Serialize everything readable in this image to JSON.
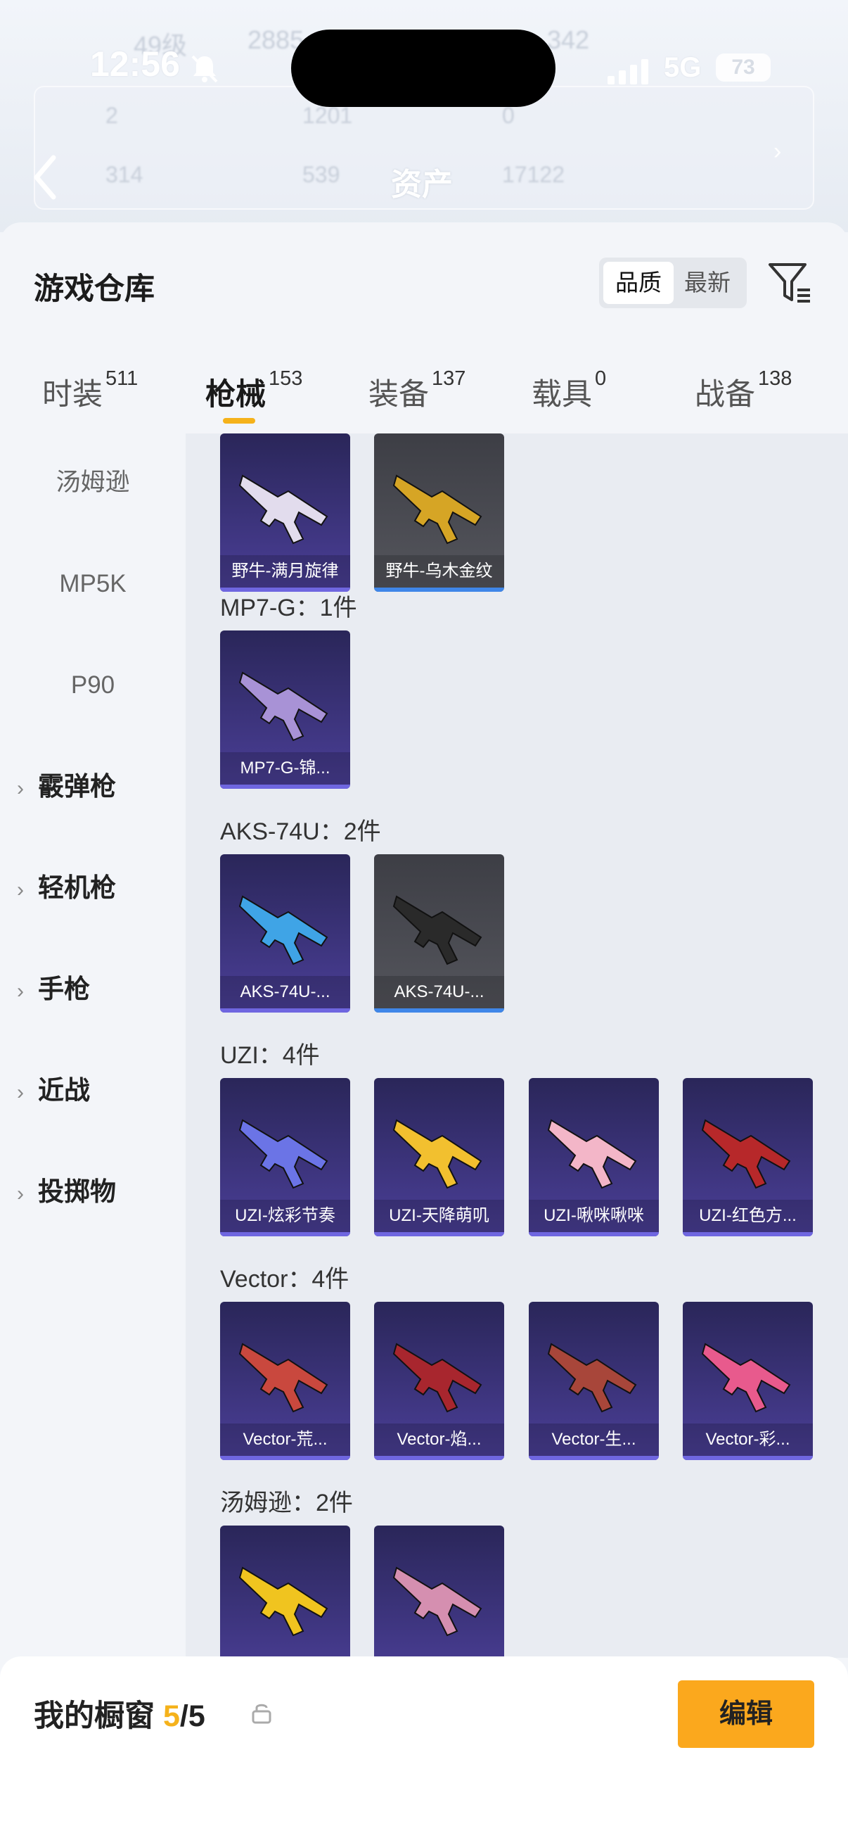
{
  "status": {
    "time": "12:56",
    "network": "5G",
    "battery": "73"
  },
  "header_bg": {
    "level": "49级",
    "coins": "2885",
    "other": "342",
    "stats": [
      "2",
      "1201",
      "0",
      "314",
      "539",
      "17122"
    ],
    "title": "资产"
  },
  "panel": {
    "title": "游戏仓库",
    "sort_options": [
      "品质",
      "最新"
    ],
    "tabs": [
      {
        "label": "时装",
        "count": "511"
      },
      {
        "label": "枪械",
        "count": "153"
      },
      {
        "label": "装备",
        "count": "137"
      },
      {
        "label": "载具",
        "count": "0"
      },
      {
        "label": "战备",
        "count": "138"
      }
    ],
    "active_tab": 1
  },
  "sidebar": {
    "items": [
      "汤姆逊",
      "MP5K",
      "P90"
    ],
    "groups": [
      "霰弹枪",
      "轻机枪",
      "手枪",
      "近战",
      "投掷物"
    ]
  },
  "content": {
    "sections": [
      {
        "title": "",
        "items": [
          {
            "name": "野牛-满月旋律",
            "gun_color": "#e2dced",
            "tone": "purple"
          },
          {
            "name": "野牛-乌木金纹",
            "gun_color": "#d6a525",
            "tone": "gray"
          }
        ]
      },
      {
        "title": "MP7-G：1件",
        "items": [
          {
            "name": "MP7-G-锦...",
            "gun_color": "#a892d6",
            "tone": "purple"
          }
        ]
      },
      {
        "title": "AKS-74U：2件",
        "items": [
          {
            "name": "AKS-74U-...",
            "gun_color": "#3fa4e6",
            "tone": "purple"
          },
          {
            "name": "AKS-74U-...",
            "gun_color": "#2a2a2a",
            "tone": "gray"
          }
        ]
      },
      {
        "title": "UZI：4件",
        "items": [
          {
            "name": "UZI-炫彩节奏",
            "gun_color": "#6b74e6",
            "tone": "purple"
          },
          {
            "name": "UZI-天降萌叽",
            "gun_color": "#f2c02f",
            "tone": "purple"
          },
          {
            "name": "UZI-啾咪啾咪",
            "gun_color": "#f3b6c8",
            "tone": "purple"
          },
          {
            "name": "UZI-红色方...",
            "gun_color": "#b7282a",
            "tone": "purple"
          }
        ]
      },
      {
        "title": "Vector：4件",
        "items": [
          {
            "name": "Vector-荒...",
            "gun_color": "#c9483e",
            "tone": "purple"
          },
          {
            "name": "Vector-焰...",
            "gun_color": "#a8262e",
            "tone": "purple"
          },
          {
            "name": "Vector-生...",
            "gun_color": "#a8463a",
            "tone": "purple"
          },
          {
            "name": "Vector-彩...",
            "gun_color": "#e85a8d",
            "tone": "purple"
          }
        ]
      },
      {
        "title": "汤姆逊：2件",
        "items": [
          {
            "name": "",
            "gun_color": "#f0c41f",
            "tone": "purple"
          },
          {
            "name": "",
            "gun_color": "#d58fb0",
            "tone": "purple"
          }
        ]
      }
    ]
  },
  "bottom": {
    "label": "我的橱窗",
    "count": "5",
    "total": "/5",
    "edit_label": "编辑"
  },
  "colors": {
    "accent": "#fba81d",
    "tab_underline": "#f5b21b"
  }
}
